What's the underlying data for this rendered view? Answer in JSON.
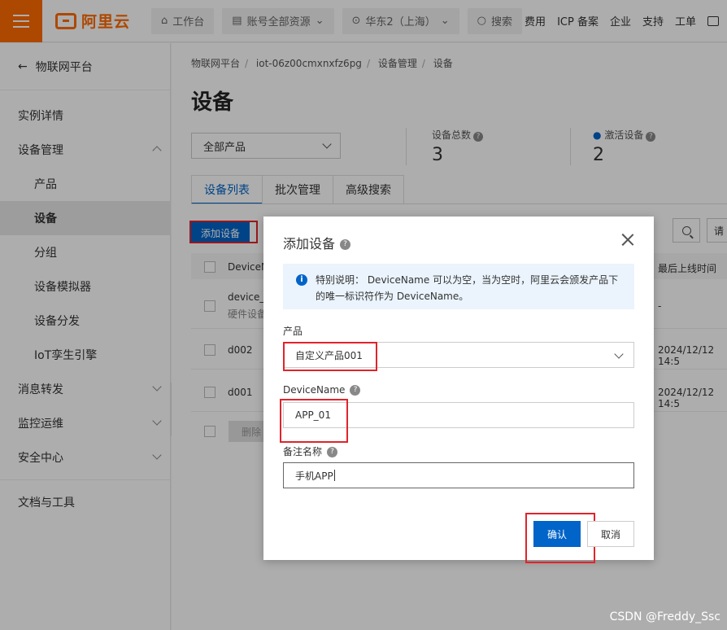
{
  "topbar": {
    "logo_text": "阿里云",
    "workbench": "工作台",
    "account_resources": "账号全部资源",
    "region": "华东2（上海）",
    "search_placeholder": "搜索",
    "links": [
      "费用",
      "ICP 备案",
      "企业",
      "支持",
      "工单"
    ]
  },
  "sidebar": {
    "back_label": "物联网平台",
    "items": [
      {
        "label": "实例详情"
      },
      {
        "label": "设备管理"
      },
      {
        "label": "产品"
      },
      {
        "label": "设备"
      },
      {
        "label": "分组"
      },
      {
        "label": "设备模拟器"
      },
      {
        "label": "设备分发"
      },
      {
        "label": "IoT孪生引擎"
      },
      {
        "label": "消息转发"
      },
      {
        "label": "监控运维"
      },
      {
        "label": "安全中心"
      },
      {
        "label": "文档与工具"
      }
    ]
  },
  "main": {
    "breadcrumb": [
      "物联网平台",
      "iot-06z00cmxnxfz6pg",
      "设备管理",
      "设备"
    ],
    "title": "设备",
    "product_filter": "全部产品",
    "stats": {
      "total_label": "设备总数",
      "total_value": "3",
      "active_label": "激活设备",
      "active_value": "2"
    },
    "tabs": [
      "设备列表",
      "批次管理",
      "高级搜索"
    ],
    "add_button": "添加设备",
    "more_button": "请",
    "table": {
      "col_name": "DeviceN",
      "col_last_online": "最后上线时间",
      "rows": [
        {
          "name": "device_0",
          "sub": "硬件设备",
          "last_online": "-"
        },
        {
          "name": "d002",
          "last_online": "2024/12/12 14:5"
        },
        {
          "name": "d001",
          "last_online": "2024/12/12 14:5"
        }
      ],
      "delete_button": "删除"
    }
  },
  "dialog": {
    "title": "添加设备",
    "notice": "特别说明：  DeviceName 可以为空，当为空时，阿里云会颁发产品下的唯一标识符作为 DeviceName。",
    "product_label": "产品",
    "product_value": "自定义产品001",
    "devicename_label": "DeviceName",
    "devicename_value": "APP_01",
    "remark_label": "备注名称",
    "remark_value": "手机APP",
    "ok_button": "确认",
    "cancel_button": "取消"
  },
  "watermark": "CSDN @Freddy_Ssc",
  "colors": {
    "brand": "#ff6a00",
    "primary": "#0064c8",
    "highlight": "#e0242a"
  }
}
